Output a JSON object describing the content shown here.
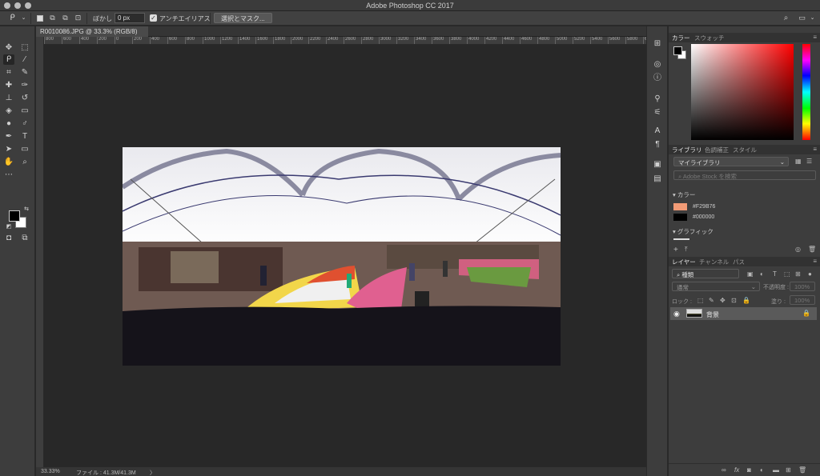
{
  "window": {
    "title": "Adobe Photoshop CC 2017"
  },
  "options_bar": {
    "feather_label": "ぼかし :",
    "feather_value": "0 px",
    "antialias_label": "アンチエイリアス",
    "antialias_checked": true,
    "select_mask_button": "選択とマスク..."
  },
  "document": {
    "tab_title": "R0010086.JPG @ 33.3% (RGB/8)",
    "ruler_ticks": [
      "800",
      "600",
      "400",
      "200",
      "0",
      "200",
      "400",
      "600",
      "800",
      "1000",
      "1200",
      "1400",
      "1600",
      "1800",
      "2000",
      "2200",
      "2400",
      "2600",
      "2800",
      "3000",
      "3200",
      "3400",
      "3600",
      "3800",
      "4000",
      "4200",
      "4400",
      "4600",
      "4800",
      "5000",
      "5200",
      "5400",
      "5600",
      "5800",
      "6000",
      "6200"
    ]
  },
  "status_bar": {
    "zoom": "33.33%",
    "file_info": "ファイル : 41.3M/41.3M",
    "arrow": "〉"
  },
  "color_panel": {
    "tabs": [
      "カラー",
      "スウォッチ"
    ],
    "foreground": "#000000",
    "background": "#ffffff",
    "hue": "#ff0000"
  },
  "libraries_panel": {
    "tabs": [
      "ライブラリ",
      "色調補正",
      "スタイル"
    ],
    "library_select": "マイライブラリ",
    "search_placeholder": "Adobe Stock を検索",
    "colors_heading": "カラー",
    "swatches": [
      {
        "label": "#F29B76",
        "color": "#f29b76"
      },
      {
        "label": "#000000",
        "color": "#000000"
      }
    ],
    "graphics_heading": "グラフィック"
  },
  "layers_panel": {
    "tabs": [
      "レイヤー",
      "チャンネル",
      "パス"
    ],
    "filter_kind": "種類",
    "blend_mode": "通常",
    "opacity_label": "不透明度 :",
    "opacity_value": "100%",
    "lock_label": "ロック :",
    "fill_label": "塗り :",
    "fill_value": "100%",
    "layers": [
      {
        "name": "背景",
        "visible": true,
        "locked": true
      }
    ]
  }
}
